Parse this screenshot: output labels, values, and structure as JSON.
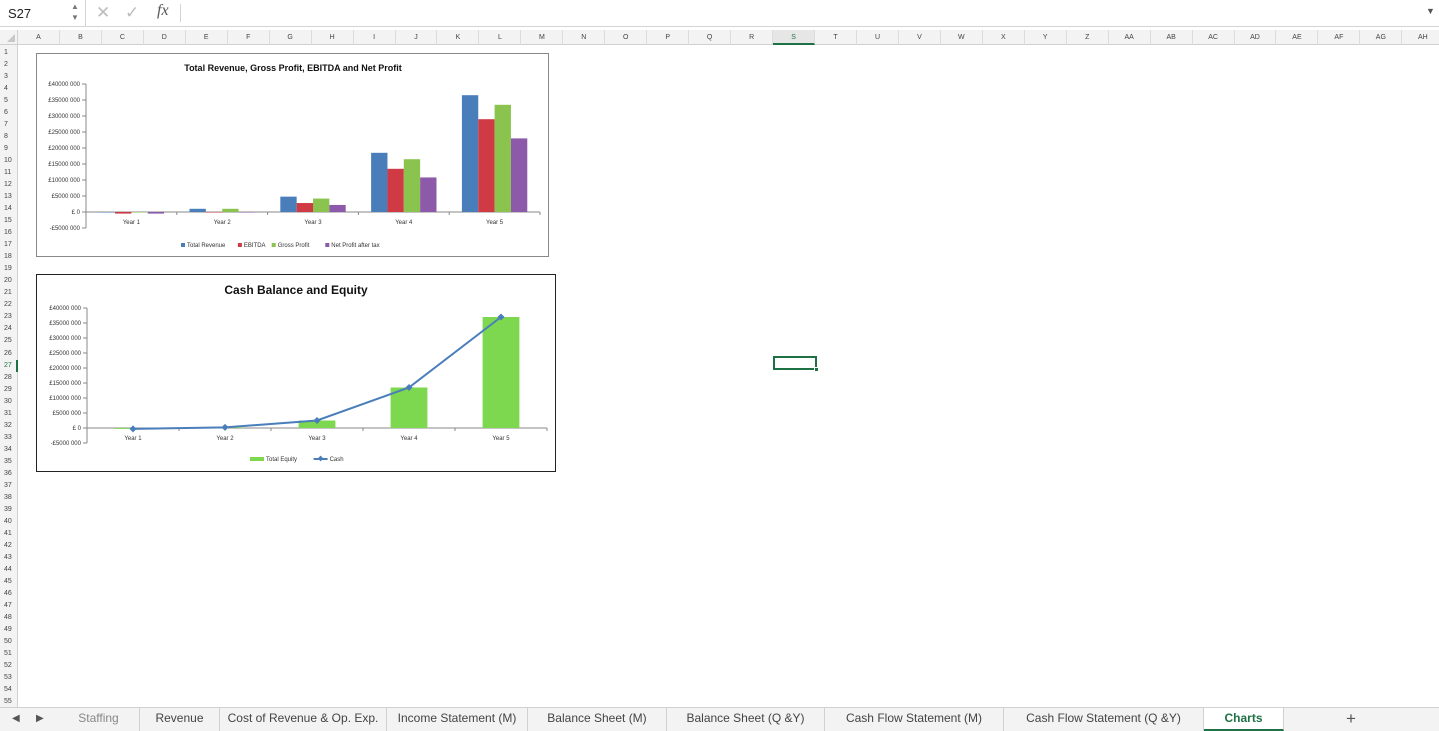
{
  "formula_bar": {
    "cell_ref": "S27",
    "fx_label": "fx",
    "value": ""
  },
  "columns": [
    "A",
    "B",
    "C",
    "D",
    "E",
    "F",
    "G",
    "H",
    "I",
    "J",
    "K",
    "L",
    "M",
    "N",
    "O",
    "P",
    "Q",
    "R",
    "S",
    "T",
    "U",
    "V",
    "W",
    "X",
    "Y",
    "Z",
    "AA",
    "AB",
    "AC",
    "AD",
    "AE",
    "AF",
    "AG",
    "AH"
  ],
  "selected_column": "S",
  "rows_count": 55,
  "selected_row": 27,
  "chart_data": [
    {
      "type": "bar",
      "title": "Total Revenue, Gross Profit, EBITDA and Net Profit",
      "categories": [
        "Year 1",
        "Year 2",
        "Year 3",
        "Year 4",
        "Year 5"
      ],
      "series": [
        {
          "name": "Total Revenue",
          "color": "#4a7ebb",
          "values": [
            0,
            1000000,
            4800000,
            18500000,
            36500000
          ]
        },
        {
          "name": "EBITDA",
          "color": "#cf3a45",
          "values": [
            -500000,
            -100000,
            2800000,
            13500000,
            29000000
          ]
        },
        {
          "name": "Gross Profit",
          "color": "#8ac44f",
          "values": [
            0,
            1000000,
            4200000,
            16500000,
            33500000
          ]
        },
        {
          "name": "Net Profit after tax",
          "color": "#8c5aa9",
          "values": [
            -500000,
            -100000,
            2200000,
            10800000,
            23000000
          ]
        }
      ],
      "yticks": [
        "£40000 000",
        "£35000 000",
        "£30000 000",
        "£25000 000",
        "£20000 000",
        "£15000 000",
        "£10000 000",
        "£5000 000",
        "£ 0",
        "-£5000 000"
      ],
      "ylim": [
        -5000000,
        40000000
      ],
      "legend": "bottom"
    },
    {
      "type": "bar+line",
      "title": "Cash Balance and Equity",
      "categories": [
        "Year 1",
        "Year 2",
        "Year 3",
        "Year 4",
        "Year 5"
      ],
      "series": [
        {
          "name": "Total Equity",
          "type": "bar",
          "color": "#7ed84f",
          "values": [
            -300000,
            200000,
            2500000,
            13500000,
            37000000
          ]
        },
        {
          "name": "Cash",
          "type": "line",
          "color": "#4a7ebb",
          "values": [
            -300000,
            200000,
            2500000,
            13500000,
            37000000
          ]
        }
      ],
      "yticks": [
        "£40000 000",
        "£35000 000",
        "£30000 000",
        "£25000 000",
        "£20000 000",
        "£15000 000",
        "£10000 000",
        "£5000 000",
        "£ 0",
        "-£5000 000"
      ],
      "ylim": [
        -5000000,
        40000000
      ],
      "legend": "bottom"
    }
  ],
  "sheet_tabs": [
    {
      "label": "Staffing"
    },
    {
      "label": "Revenue"
    },
    {
      "label": "Cost of Revenue & Op. Exp."
    },
    {
      "label": "Income Statement (M)"
    },
    {
      "label": "Balance Sheet (M)"
    },
    {
      "label": "Balance Sheet (Q &Y)"
    },
    {
      "label": "Cash Flow Statement (M)"
    },
    {
      "label": "Cash Flow Statement (Q &Y)"
    },
    {
      "label": "Charts"
    }
  ],
  "active_tab": "Charts",
  "add_tab_label": "+"
}
